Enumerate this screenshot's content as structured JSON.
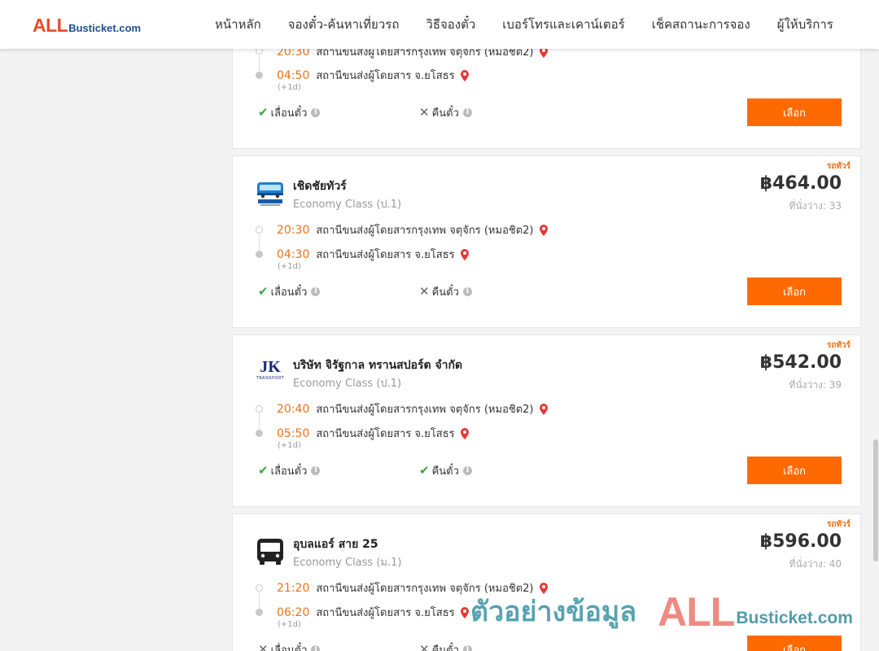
{
  "header": {
    "logo": {
      "all": "ALL",
      "rest": "Busticket.com"
    },
    "nav": [
      "หน้าหลัก",
      "จองตั๋ว-ค้นหาเที่ยวรถ",
      "วิธีจองตั๋ว",
      "เบอร์โทรและเคาน์เตอร์",
      "เช็คสถานะการจอง",
      "ผู้ให้บริการ"
    ]
  },
  "cards": [
    {
      "depart_time": "20:30",
      "depart_place": "สถานีขนส่งผู้โดยสารกรุงเทพ จตุจักร (หมอชิต2)",
      "arrive_time": "04:50",
      "arrive_place": "สถานีขนส่งผู้โดยสาร จ.ยโสธร",
      "plus_day": "(+1d)",
      "change_ticket": "เลื่อนตั๋ว",
      "refund_ticket": "คืนตั๋ว",
      "change_allowed": true,
      "refund_allowed": false,
      "button": "เลือก"
    },
    {
      "bus_type": "รถทัวร์",
      "operator": "เชิดชัยทัวร์",
      "class": "Economy Class (ป.1)",
      "price": "฿464.00",
      "seats_label": "ที่นั่งว่าง:",
      "seats": "33",
      "depart_time": "20:30",
      "depart_place": "สถานีขนส่งผู้โดยสารกรุงเทพ จตุจักร (หมอชิต2)",
      "arrive_time": "04:30",
      "arrive_place": "สถานีขนส่งผู้โดยสาร จ.ยโสธร",
      "plus_day": "(+1d)",
      "change_ticket": "เลื่อนตั๋ว",
      "refund_ticket": "คืนตั๋ว",
      "change_allowed": true,
      "refund_allowed": false,
      "button": "เลือก",
      "logo_icon": "cherdchai-bus-logo"
    },
    {
      "bus_type": "รถทัวร์",
      "operator": "บริษัท จิรัฐกาล ทรานสปอร์ต จำกัด",
      "class": "Economy Class (ป.1)",
      "price": "฿542.00",
      "seats_label": "ที่นั่งว่าง:",
      "seats": "39",
      "depart_time": "20:40",
      "depart_place": "สถานีขนส่งผู้โดยสารกรุงเทพ จตุจักร (หมอชิต2)",
      "arrive_time": "05:50",
      "arrive_place": "สถานีขนส่งผู้โดยสาร จ.ยโสธร",
      "plus_day": "(+1d)",
      "change_ticket": "เลื่อนตั๋ว",
      "refund_ticket": "คืนตั๋ว",
      "change_allowed": true,
      "refund_allowed": true,
      "button": "เลือก",
      "logo_text": "JK",
      "logo_sub": "TRANSPORT"
    },
    {
      "bus_type": "รถทัวร์",
      "operator": "อุบลแอร์ สาย 25",
      "class": "Economy Class (ม.1)",
      "price": "฿596.00",
      "seats_label": "ที่นั่งว่าง:",
      "seats": "40",
      "depart_time": "21:20",
      "depart_place": "สถานีขนส่งผู้โดยสารกรุงเทพ จตุจักร (หมอชิต2)",
      "arrive_time": "06:20",
      "arrive_place": "สถานีขนส่งผู้โดยสาร จ.ยโสธร",
      "plus_day": "(+1d)",
      "change_ticket": "เลื่อนตั๋ว",
      "refund_ticket": "คืนตั๋ว",
      "change_allowed": false,
      "refund_allowed": false,
      "button": "เลือก",
      "logo_icon": "bus-icon"
    }
  ],
  "watermark": {
    "text": "ตัวอย่างข้อมูล",
    "all": "ALL",
    "rest": "Busticket.com"
  },
  "colors": {
    "accent": "#ff6a00",
    "time": "#f07016",
    "pin": "#e53935",
    "ok": "#3aa845"
  }
}
